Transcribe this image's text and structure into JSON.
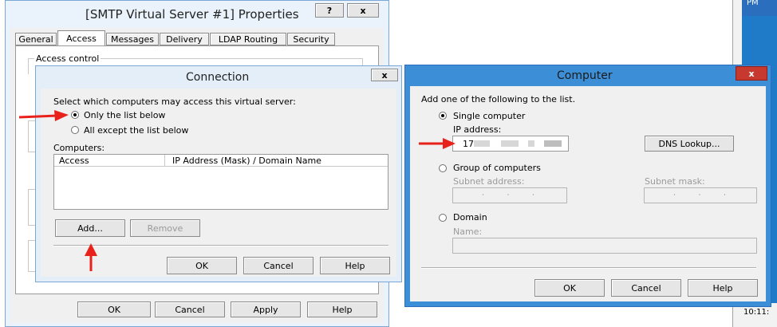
{
  "properties": {
    "title": "[SMTP Virtual Server #1] Properties",
    "help_btn": "?",
    "close_btn": "x",
    "tabs": [
      "General",
      "Access",
      "Messages",
      "Delivery",
      "LDAP Routing",
      "Security"
    ],
    "access_control_label": "Access control",
    "ok": "OK",
    "cancel": "Cancel",
    "apply": "Apply",
    "help": "Help"
  },
  "connection": {
    "title": "Connection",
    "close_btn": "x",
    "instruction": "Select which computers may access this virtual server:",
    "option_only": "Only the list below",
    "option_except": "All except the list below",
    "computers_label": "Computers:",
    "columns": [
      "Access",
      "IP Address (Mask) / Domain Name"
    ],
    "add": "Add...",
    "remove": "Remove",
    "ok": "OK",
    "cancel": "Cancel",
    "help": "Help"
  },
  "computer": {
    "title": "Computer",
    "close_btn": "x",
    "instruction": "Add one of the following to the list.",
    "single_label": "Single computer",
    "ip_label": "IP address:",
    "ip_value": "17",
    "dns_lookup": "DNS Lookup...",
    "group_label": "Group of computers",
    "subnet_address_label": "Subnet address:",
    "subnet_mask_label": "Subnet mask:",
    "domain_label": "Domain",
    "name_label": "Name:",
    "ok": "OK",
    "cancel": "Cancel",
    "help": "Help"
  },
  "taskbar": {
    "top_text": "PM",
    "clock": "10:11:"
  },
  "colors": {
    "window_border": "#3c8fd6",
    "close_red": "#c7392f",
    "annotation_red": "#e8221a"
  }
}
